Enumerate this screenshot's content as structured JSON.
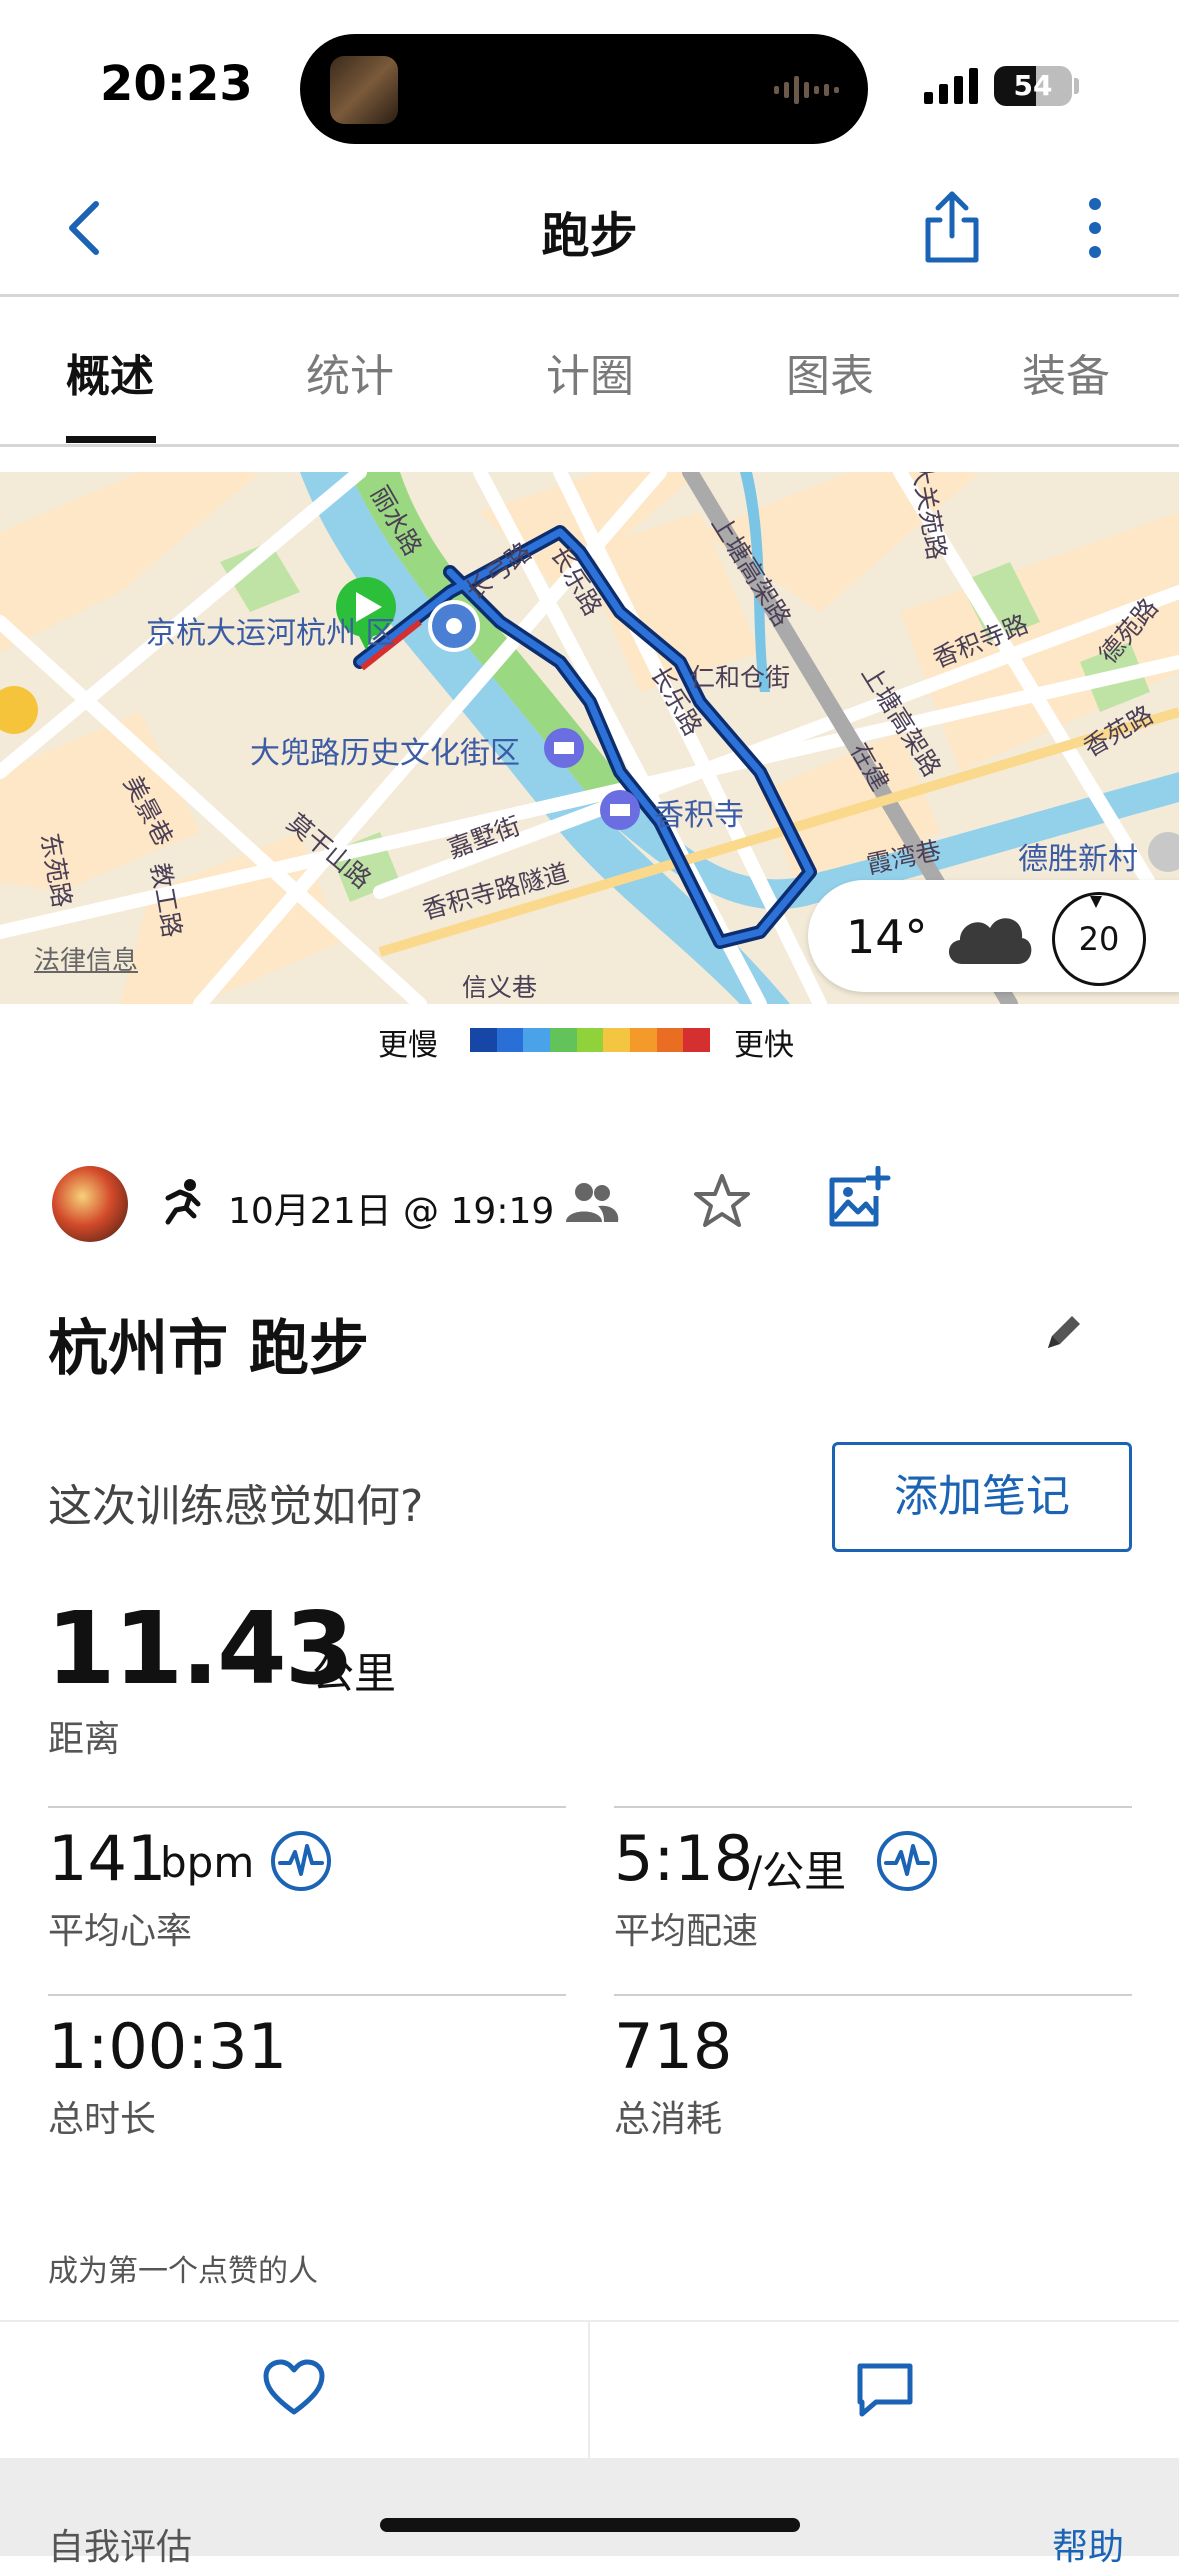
{
  "status_bar": {
    "time": "20:23",
    "battery": "54"
  },
  "nav": {
    "title": "跑步"
  },
  "tabs": [
    {
      "label": "概述",
      "active": true
    },
    {
      "label": "统计",
      "active": false
    },
    {
      "label": "计圈",
      "active": false
    },
    {
      "label": "图表",
      "active": false
    },
    {
      "label": "装备",
      "active": false
    }
  ],
  "map": {
    "labels": {
      "canal_area": "京杭大运河杭州 区",
      "dadou_street": "大兜路历史文化街区",
      "xiangji_temple": "香积寺",
      "deshengxincun": "德胜新村",
      "changle_road_1": "长乐路",
      "changle_road_2": "长乐路",
      "shanghe_road": "上塘高架路",
      "shanghe_road_2": "上塘高架路",
      "xiangjisi_road": "香积寺路",
      "xiangjisi_tunnel": "香积寺路隧道",
      "moganshan_road": "莫干山路",
      "lishui_road": "丽水路",
      "renhecang_street": "仁和仓街",
      "changgong_road": "长弓路",
      "jiayi_street": "嘉墅街",
      "xinyi_lane": "信义巷",
      "xiawan_lane": "霞湾巷",
      "jiaogong_road": "教工路",
      "dayuan_road": "大关苑路",
      "desheng_lane": "德苑路",
      "xiangyuan_road": "香苑路",
      "dongyuan_lane": "东苑路",
      "zaijian": "在建",
      "meiyuan": "美景巷"
    },
    "legal_link": "法律信息",
    "weather": {
      "temp": "14°",
      "wind": "20"
    },
    "route_color": "#1b4fa8",
    "start_marker_color": "#2bbf3a"
  },
  "legend": {
    "slower": "更慢",
    "faster": "更快",
    "colors": [
      "#1747a6",
      "#2a6fd6",
      "#4aa3e8",
      "#62c35a",
      "#8fd23a",
      "#f4c542",
      "#f39a2b",
      "#ea6d24",
      "#d62f2f"
    ]
  },
  "activity": {
    "date": "10月21日 @ 19:19",
    "title": "杭州市 跑步",
    "feel_question": "这次训练感觉如何?",
    "add_note": "添加笔记"
  },
  "stats": {
    "distance": {
      "value": "11.43",
      "unit": "公里",
      "label": "距离"
    },
    "heart_rate": {
      "value": "141",
      "unit": "bpm",
      "label": "平均心率"
    },
    "pace": {
      "value": "5:18",
      "unit": "/公里",
      "label": "平均配速"
    },
    "duration": {
      "value": "1:00:31",
      "label": "总时长"
    },
    "calories": {
      "value": "718",
      "label": "总消耗"
    }
  },
  "social": {
    "like_prompt": "成为第一个点赞的人"
  },
  "footer": {
    "self_eval": "自我评估",
    "help": "帮助"
  }
}
